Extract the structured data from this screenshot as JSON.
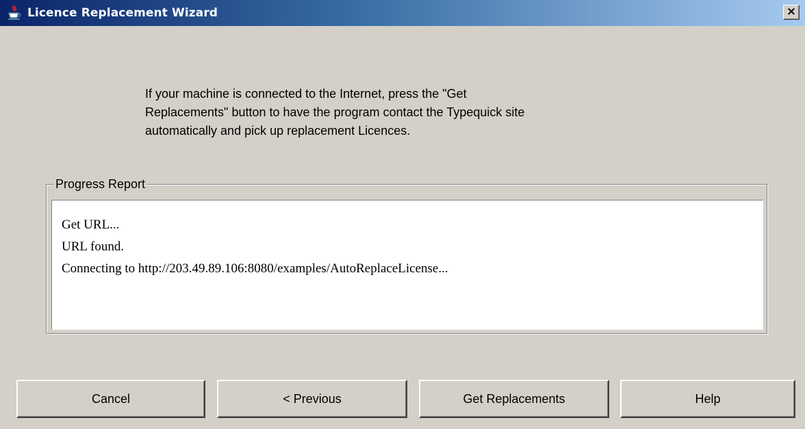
{
  "window": {
    "title": "Licence Replacement Wizard",
    "icon": "java-cup-icon",
    "close_label": "×"
  },
  "instructions": "If your machine is connected to the Internet, press the \"Get\nReplacements\" button to have the program contact the Typequick site\nautomatically and pick up replacement Licences.",
  "progress": {
    "legend": "Progress Report",
    "lines": [
      "Get URL...",
      "URL found.",
      "Connecting to http://203.49.89.106:8080/examples/AutoReplaceLicense..."
    ]
  },
  "buttons": {
    "cancel": "Cancel",
    "previous": "< Previous",
    "get_replacements": "Get Replacements",
    "help": "Help"
  },
  "colors": {
    "title_start": "#0a246a",
    "title_end": "#a6caf0",
    "face": "#d4d0c8"
  }
}
